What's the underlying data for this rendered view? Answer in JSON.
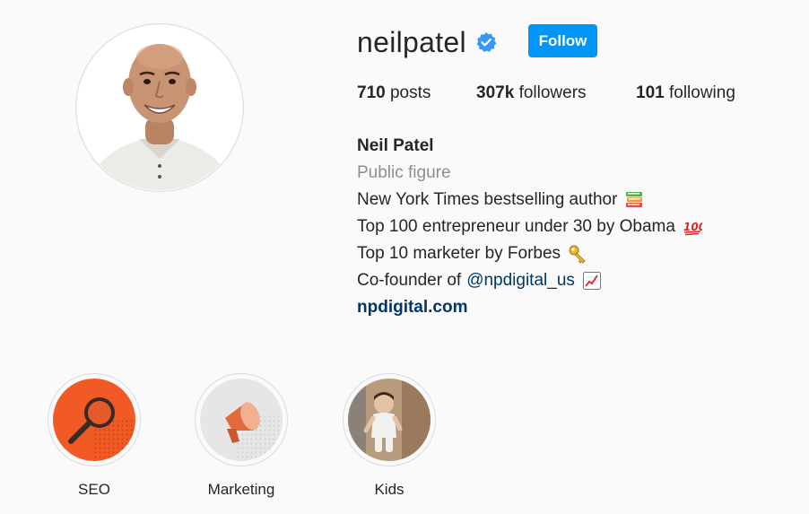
{
  "profile": {
    "username": "neilpatel",
    "follow_label": "Follow",
    "verified_icon": "verified-badge-icon",
    "avatar_icon": "profile-photo"
  },
  "stats": {
    "posts_count": "710",
    "posts_label": "posts",
    "followers_count": "307k",
    "followers_label": "followers",
    "following_count": "101",
    "following_label": "following"
  },
  "bio": {
    "name": "Neil Patel",
    "category": "Public figure",
    "line1": "New York Times bestselling author",
    "line2": "Top 100 entrepreneur under 30 by Obama",
    "line3": "Top 10 marketer by Forbes",
    "line4_prefix": "Co-founder of",
    "line4_mention": "@npdigital_us",
    "website": "npdigital.com",
    "emoji_icons": [
      "books-emoji-icon",
      "hundred-points-emoji-icon",
      "key-emoji-icon",
      "chart-increasing-emoji-icon"
    ]
  },
  "highlights": [
    {
      "label": "SEO",
      "icon": "magnifying-glass-icon",
      "color": "#f15a24"
    },
    {
      "label": "Marketing",
      "icon": "megaphone-icon",
      "color": "#e06a3b"
    },
    {
      "label": "Kids",
      "icon": "child-photo",
      "color": "#b08a6a"
    }
  ],
  "colors": {
    "accent": "#0095f6",
    "verified": "#3897f0",
    "link": "#00376b",
    "muted": "#8e8e8e",
    "background": "#fafafa"
  }
}
